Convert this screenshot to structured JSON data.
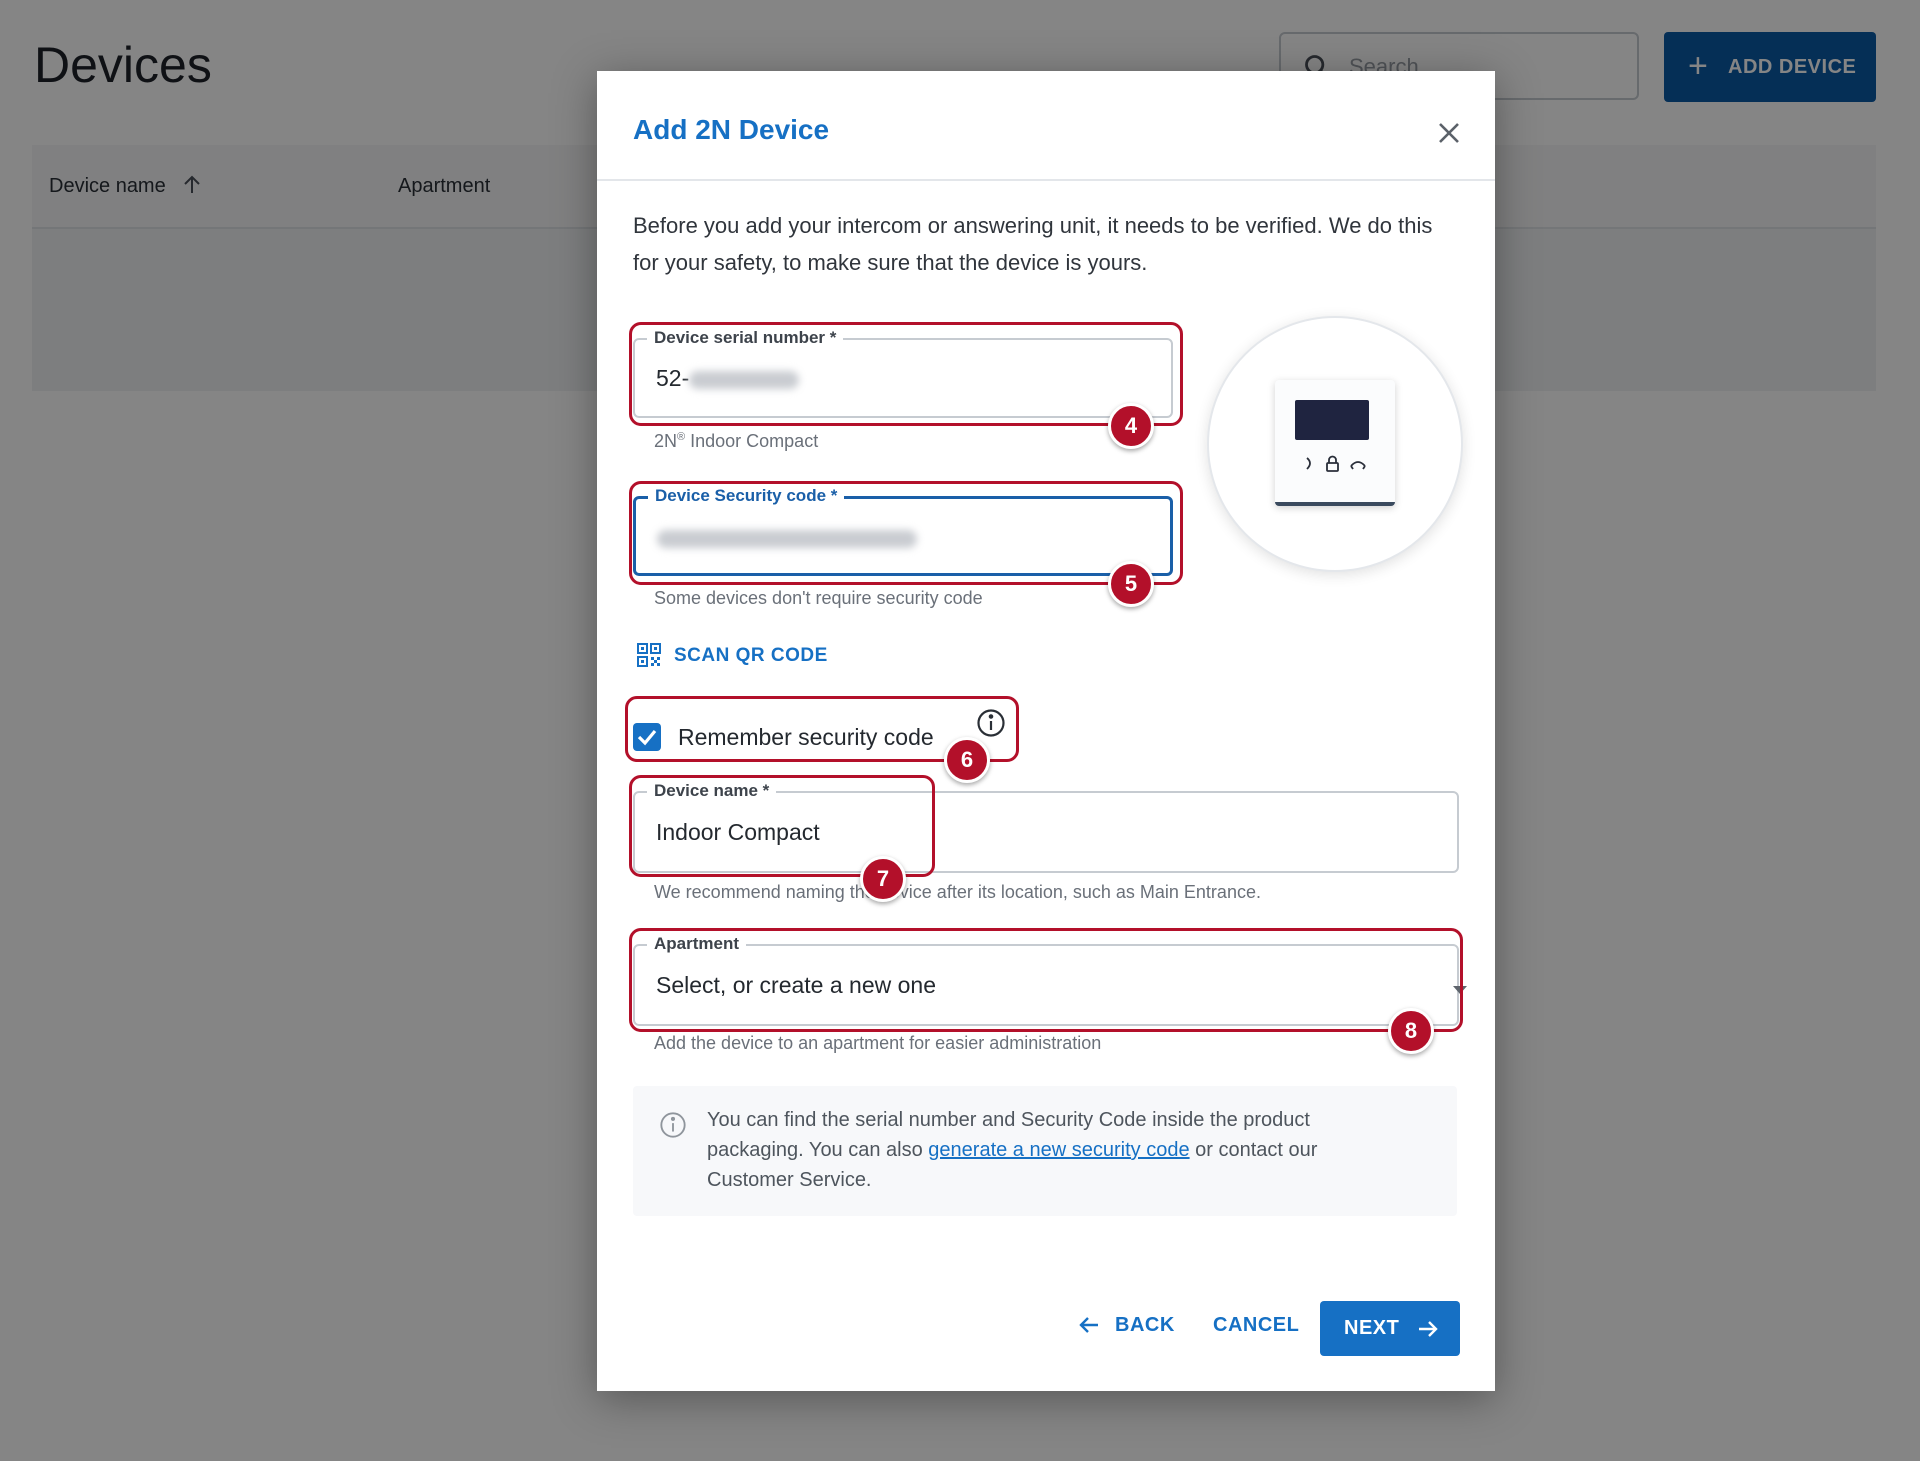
{
  "page": {
    "title": "Devices",
    "search_placeholder": "Search",
    "add_device_label": "ADD DEVICE",
    "columns": [
      "Device name",
      "Apartment"
    ]
  },
  "dialog": {
    "title": "Add 2N Device",
    "intro": "Before you add your intercom or answering unit, it needs to be verified. We do this for your safety, to make sure that the device is yours.",
    "serial": {
      "label": "Device serial number *",
      "value_prefix": "52-",
      "helper_brand": "2N",
      "helper_mark": "®",
      "helper_model": " Indoor Compact"
    },
    "security_code": {
      "label": "Device Security code *",
      "helper": "Some devices don't require security code"
    },
    "scan_qr_label": "SCAN QR CODE",
    "remember": {
      "label": "Remember security code",
      "checked": true
    },
    "device_name": {
      "label": "Device name *",
      "value": "Indoor Compact",
      "helper": "We recommend naming the device after its location, such as Main Entrance."
    },
    "apartment": {
      "label": "Apartment",
      "placeholder": "Select, or create a new one",
      "helper": "Add the device to an apartment for easier administration"
    },
    "info": {
      "text_before": "You can find the serial number and Security Code inside the product packaging. You can also ",
      "link": "generate a new security code",
      "text_after": " or contact our Customer Service."
    },
    "buttons": {
      "back": "BACK",
      "cancel": "CANCEL",
      "next": "NEXT"
    }
  },
  "callouts": [
    "4",
    "5",
    "6",
    "7",
    "8"
  ],
  "colors": {
    "accent": "#1670c4",
    "callout": "#b3102a",
    "primary_button": "#0a5aa6"
  },
  "icons": [
    "search-icon",
    "plus-icon",
    "sort-arrow-up-icon",
    "close-icon",
    "qr-code-icon",
    "checkmark-icon",
    "info-icon",
    "chevron-down-icon",
    "arrow-left-icon",
    "arrow-right-icon",
    "indoor-unit-icon"
  ]
}
